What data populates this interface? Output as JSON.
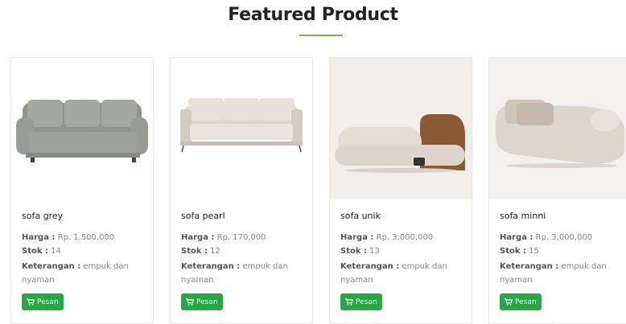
{
  "section": {
    "title": "Featured Product"
  },
  "products": [
    {
      "name": "sofa grey",
      "harga_label": "Harga :",
      "harga": "Rp. 1,500,000",
      "stok_label": "Stok :",
      "stok": "14",
      "ket_label": "Keterangan :",
      "keterangan": "empuk dan nyaman",
      "button_label": "Pesan",
      "image": "grey-sofa-image"
    },
    {
      "name": "sofa pearl",
      "harga_label": "Harga :",
      "harga": "Rp. 170,000",
      "stok_label": "Stok :",
      "stok": "12",
      "ket_label": "Keterangan :",
      "keterangan": "empuk dan nyaman",
      "button_label": "Pesan",
      "image": "pearl-sofa-image"
    },
    {
      "name": "sofa unik",
      "harga_label": "Harga :",
      "harga": "Rp. 3,000,000",
      "stok_label": "Stok :",
      "stok": "13",
      "ket_label": "Keterangan :",
      "keterangan": "empuk dan nyaman",
      "button_label": "Pesan",
      "image": "unique-sofa-image"
    },
    {
      "name": "sofa minni",
      "harga_label": "Harga :",
      "harga": "Rp. 3,000,000",
      "stok_label": "Stok :",
      "stok": "15",
      "ket_label": "Keterangan :",
      "keterangan": "empuk dan nyaman",
      "button_label": "Pesan",
      "image": "curved-sofa-image"
    }
  ],
  "colors": {
    "accent_underline": "#7cb342",
    "button_green": "#28a745"
  },
  "icons": {
    "button_icon": "shopping-cart-icon"
  }
}
